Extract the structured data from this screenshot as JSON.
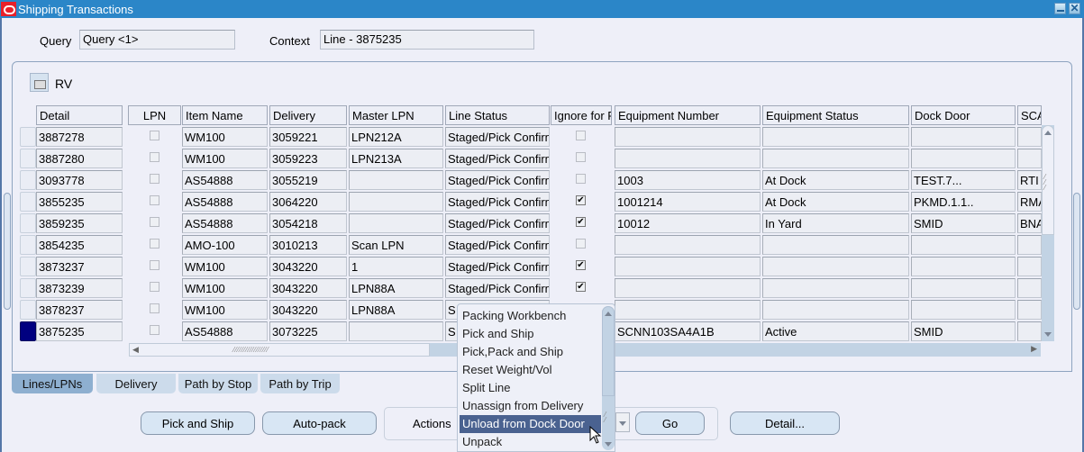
{
  "window": {
    "title": "Shipping Transactions",
    "logo_icon": "oracle-logo-icon",
    "minimize_icon": "minimize-icon",
    "close_icon": "close-icon",
    "close_glyph": "✕"
  },
  "header": {
    "query_label": "Query",
    "query_value": "Query <1>",
    "context_label": "Context",
    "context_value": "Line - 3875235"
  },
  "panel": {
    "folder_icon": "folder-open-icon",
    "folder_label": "RV"
  },
  "table": {
    "columns": [
      "Detail",
      "LPN",
      "Item Name",
      "Delivery",
      "Master LPN",
      "Line Status",
      "Ignore for P",
      "Equipment Number",
      "Equipment Status",
      "Dock Door",
      "SCA"
    ],
    "rows": [
      {
        "detail": "3887278",
        "lpn": false,
        "item": "WM100",
        "delivery": "3059221",
        "master_lpn": "LPN212A",
        "line_status": "Staged/Pick Confirm",
        "ignore": false,
        "equip_num": "",
        "equip_status": "",
        "dock_door": "",
        "sca": "",
        "selected": false
      },
      {
        "detail": "3887280",
        "lpn": false,
        "item": "WM100",
        "delivery": "3059223",
        "master_lpn": "LPN213A",
        "line_status": "Staged/Pick Confirm",
        "ignore": false,
        "equip_num": "",
        "equip_status": "",
        "dock_door": "",
        "sca": "",
        "selected": false
      },
      {
        "detail": "3093778",
        "lpn": false,
        "item": "AS54888",
        "delivery": "3055219",
        "master_lpn": "",
        "line_status": "Staged/Pick Confirm",
        "ignore": false,
        "equip_num": "1003",
        "equip_status": "At Dock",
        "dock_door": "TEST.7...",
        "sca": "RTI",
        "selected": false
      },
      {
        "detail": "3855235",
        "lpn": false,
        "item": "AS54888",
        "delivery": "3064220",
        "master_lpn": "",
        "line_status": "Staged/Pick Confirm",
        "ignore": true,
        "equip_num": "1001214",
        "equip_status": "At Dock",
        "dock_door": "PKMD.1.1..",
        "sca": "RMA",
        "selected": false
      },
      {
        "detail": "3859235",
        "lpn": false,
        "item": "AS54888",
        "delivery": "3054218",
        "master_lpn": "",
        "line_status": "Staged/Pick Confirm",
        "ignore": true,
        "equip_num": "10012",
        "equip_status": "In Yard",
        "dock_door": "SMID",
        "sca": "BNA",
        "selected": false
      },
      {
        "detail": "3854235",
        "lpn": false,
        "item": "AMO-100",
        "delivery": "3010213",
        "master_lpn": "Scan LPN",
        "line_status": "Staged/Pick Confirm",
        "ignore": false,
        "equip_num": "",
        "equip_status": "",
        "dock_door": "",
        "sca": "",
        "selected": false
      },
      {
        "detail": "3873237",
        "lpn": false,
        "item": "WM100",
        "delivery": "3043220",
        "master_lpn": "1",
        "line_status": "Staged/Pick Confirm",
        "ignore": true,
        "equip_num": "",
        "equip_status": "",
        "dock_door": "",
        "sca": "",
        "selected": false
      },
      {
        "detail": "3873239",
        "lpn": false,
        "item": "WM100",
        "delivery": "3043220",
        "master_lpn": "LPN88A",
        "line_status": "Staged/Pick Confirm",
        "ignore": true,
        "equip_num": "",
        "equip_status": "",
        "dock_door": "",
        "sca": "",
        "selected": false
      },
      {
        "detail": "3878237",
        "lpn": false,
        "item": "WM100",
        "delivery": "3043220",
        "master_lpn": "LPN88A",
        "line_status": "S",
        "ignore": null,
        "equip_num": "",
        "equip_status": "",
        "dock_door": "",
        "sca": "",
        "selected": false
      },
      {
        "detail": "3875235",
        "lpn": false,
        "item": "AS54888",
        "delivery": "3073225",
        "master_lpn": "",
        "line_status": "S",
        "ignore": null,
        "equip_num": "SCNN103SA4A1B",
        "equip_status": "Active",
        "dock_door": "SMID",
        "sca": "",
        "selected": true
      }
    ]
  },
  "tabs": [
    {
      "label": "Lines/LPNs",
      "active": true
    },
    {
      "label": "Delivery",
      "active": false
    },
    {
      "label": "Path by Stop",
      "active": false
    },
    {
      "label": "Path by Trip",
      "active": false
    }
  ],
  "buttons": {
    "pick_and_ship": "Pick and Ship",
    "auto_pack": "Auto-pack",
    "actions_label": "Actions",
    "go": "Go",
    "detail": "Detail..."
  },
  "actions_dropdown": {
    "items": [
      {
        "label": "Packing Workbench",
        "highlighted": false
      },
      {
        "label": "Pick and Ship",
        "highlighted": false
      },
      {
        "label": "Pick,Pack and Ship",
        "highlighted": false
      },
      {
        "label": "Reset Weight/Vol",
        "highlighted": false
      },
      {
        "label": "Split Line",
        "highlighted": false
      },
      {
        "label": "Unassign from Delivery",
        "highlighted": false
      },
      {
        "label": "Unload from Dock Door",
        "highlighted": true
      },
      {
        "label": "Unpack",
        "highlighted": false
      }
    ]
  }
}
